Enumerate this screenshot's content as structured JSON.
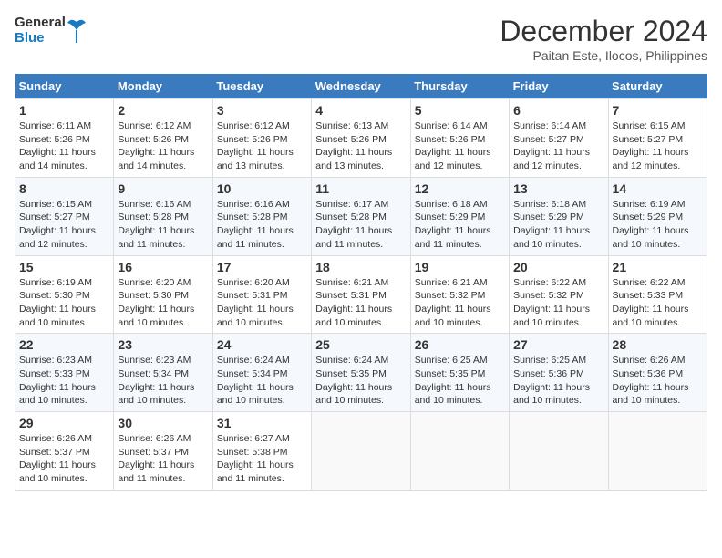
{
  "header": {
    "logo_line1": "General",
    "logo_line2": "Blue",
    "month": "December 2024",
    "location": "Paitan Este, Ilocos, Philippines"
  },
  "days_of_week": [
    "Sunday",
    "Monday",
    "Tuesday",
    "Wednesday",
    "Thursday",
    "Friday",
    "Saturday"
  ],
  "weeks": [
    [
      {
        "day": 1,
        "sunrise": "6:11 AM",
        "sunset": "5:26 PM",
        "daylight": "11 hours and 14 minutes."
      },
      {
        "day": 2,
        "sunrise": "6:12 AM",
        "sunset": "5:26 PM",
        "daylight": "11 hours and 14 minutes."
      },
      {
        "day": 3,
        "sunrise": "6:12 AM",
        "sunset": "5:26 PM",
        "daylight": "11 hours and 13 minutes."
      },
      {
        "day": 4,
        "sunrise": "6:13 AM",
        "sunset": "5:26 PM",
        "daylight": "11 hours and 13 minutes."
      },
      {
        "day": 5,
        "sunrise": "6:14 AM",
        "sunset": "5:26 PM",
        "daylight": "11 hours and 12 minutes."
      },
      {
        "day": 6,
        "sunrise": "6:14 AM",
        "sunset": "5:27 PM",
        "daylight": "11 hours and 12 minutes."
      },
      {
        "day": 7,
        "sunrise": "6:15 AM",
        "sunset": "5:27 PM",
        "daylight": "11 hours and 12 minutes."
      }
    ],
    [
      {
        "day": 8,
        "sunrise": "6:15 AM",
        "sunset": "5:27 PM",
        "daylight": "11 hours and 12 minutes."
      },
      {
        "day": 9,
        "sunrise": "6:16 AM",
        "sunset": "5:28 PM",
        "daylight": "11 hours and 11 minutes."
      },
      {
        "day": 10,
        "sunrise": "6:16 AM",
        "sunset": "5:28 PM",
        "daylight": "11 hours and 11 minutes."
      },
      {
        "day": 11,
        "sunrise": "6:17 AM",
        "sunset": "5:28 PM",
        "daylight": "11 hours and 11 minutes."
      },
      {
        "day": 12,
        "sunrise": "6:18 AM",
        "sunset": "5:29 PM",
        "daylight": "11 hours and 11 minutes."
      },
      {
        "day": 13,
        "sunrise": "6:18 AM",
        "sunset": "5:29 PM",
        "daylight": "11 hours and 10 minutes."
      },
      {
        "day": 14,
        "sunrise": "6:19 AM",
        "sunset": "5:29 PM",
        "daylight": "11 hours and 10 minutes."
      }
    ],
    [
      {
        "day": 15,
        "sunrise": "6:19 AM",
        "sunset": "5:30 PM",
        "daylight": "11 hours and 10 minutes."
      },
      {
        "day": 16,
        "sunrise": "6:20 AM",
        "sunset": "5:30 PM",
        "daylight": "11 hours and 10 minutes."
      },
      {
        "day": 17,
        "sunrise": "6:20 AM",
        "sunset": "5:31 PM",
        "daylight": "11 hours and 10 minutes."
      },
      {
        "day": 18,
        "sunrise": "6:21 AM",
        "sunset": "5:31 PM",
        "daylight": "11 hours and 10 minutes."
      },
      {
        "day": 19,
        "sunrise": "6:21 AM",
        "sunset": "5:32 PM",
        "daylight": "11 hours and 10 minutes."
      },
      {
        "day": 20,
        "sunrise": "6:22 AM",
        "sunset": "5:32 PM",
        "daylight": "11 hours and 10 minutes."
      },
      {
        "day": 21,
        "sunrise": "6:22 AM",
        "sunset": "5:33 PM",
        "daylight": "11 hours and 10 minutes."
      }
    ],
    [
      {
        "day": 22,
        "sunrise": "6:23 AM",
        "sunset": "5:33 PM",
        "daylight": "11 hours and 10 minutes."
      },
      {
        "day": 23,
        "sunrise": "6:23 AM",
        "sunset": "5:34 PM",
        "daylight": "11 hours and 10 minutes."
      },
      {
        "day": 24,
        "sunrise": "6:24 AM",
        "sunset": "5:34 PM",
        "daylight": "11 hours and 10 minutes."
      },
      {
        "day": 25,
        "sunrise": "6:24 AM",
        "sunset": "5:35 PM",
        "daylight": "11 hours and 10 minutes."
      },
      {
        "day": 26,
        "sunrise": "6:25 AM",
        "sunset": "5:35 PM",
        "daylight": "11 hours and 10 minutes."
      },
      {
        "day": 27,
        "sunrise": "6:25 AM",
        "sunset": "5:36 PM",
        "daylight": "11 hours and 10 minutes."
      },
      {
        "day": 28,
        "sunrise": "6:26 AM",
        "sunset": "5:36 PM",
        "daylight": "11 hours and 10 minutes."
      }
    ],
    [
      {
        "day": 29,
        "sunrise": "6:26 AM",
        "sunset": "5:37 PM",
        "daylight": "11 hours and 10 minutes."
      },
      {
        "day": 30,
        "sunrise": "6:26 AM",
        "sunset": "5:37 PM",
        "daylight": "11 hours and 11 minutes."
      },
      {
        "day": 31,
        "sunrise": "6:27 AM",
        "sunset": "5:38 PM",
        "daylight": "11 hours and 11 minutes."
      },
      null,
      null,
      null,
      null
    ]
  ]
}
